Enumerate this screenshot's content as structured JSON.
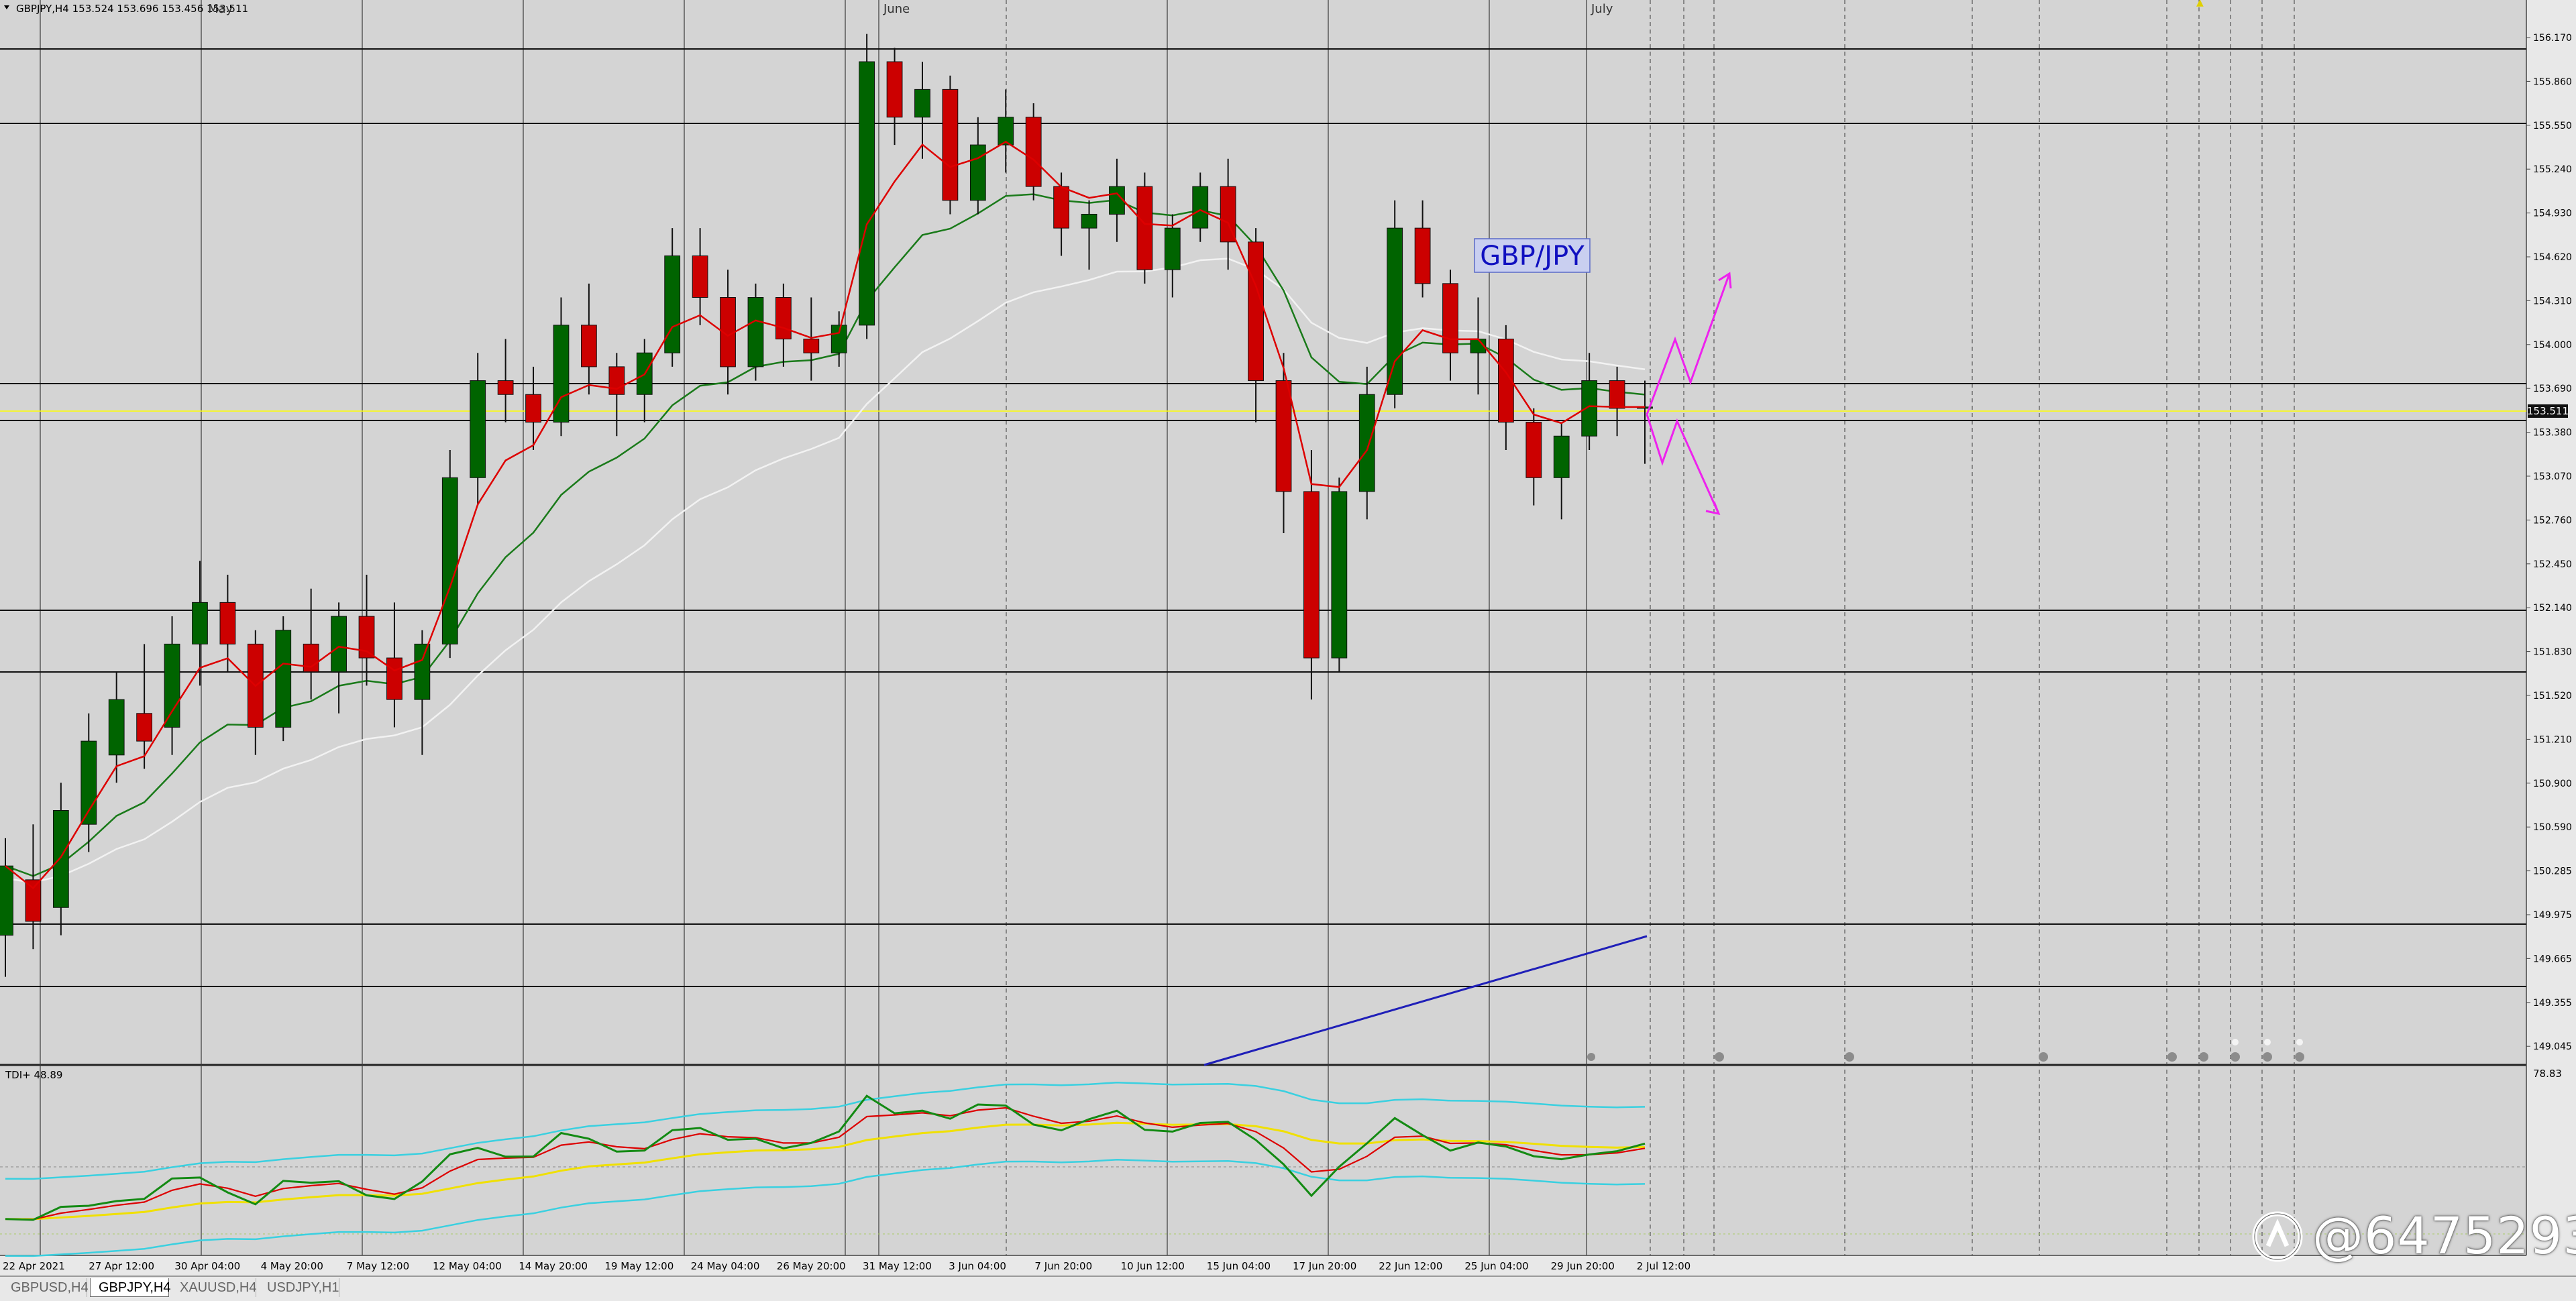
{
  "chart_header": {
    "symbol_info": "GBPJPY,H4  153.524 153.696 153.456 153.511"
  },
  "main_chart": {
    "month_labels": [
      "May",
      "June",
      "July"
    ],
    "overlay_label": "GBP/JPY",
    "current_price_tag": "153.511",
    "price_ticks": [
      "156.170",
      "155.860",
      "155.550",
      "155.240",
      "154.930",
      "154.620",
      "154.310",
      "154.000",
      "153.690",
      "153.380",
      "153.070",
      "152.760",
      "152.450",
      "152.140",
      "151.830",
      "151.520",
      "151.210",
      "150.900",
      "150.590",
      "150.285",
      "149.975",
      "149.665",
      "149.355",
      "149.045"
    ],
    "time_ticks": [
      "22 Apr 2021",
      "27 Apr 12:00",
      "30 Apr 04:00",
      "4 May 20:00",
      "7 May 12:00",
      "12 May 04:00",
      "14 May 20:00",
      "19 May 12:00",
      "24 May 04:00",
      "26 May 20:00",
      "31 May 12:00",
      "3 Jun 04:00",
      "7 Jun 20:00",
      "10 Jun 12:00",
      "15 Jun 04:00",
      "17 Jun 20:00",
      "22 Jun 12:00",
      "25 Jun 04:00",
      "29 Jun 20:00",
      "2 Jul 12:00"
    ]
  },
  "indicator": {
    "label": "TDI+ 48.89",
    "top_value": "78.83"
  },
  "tabs": [
    {
      "label": "GBPUSD,H4",
      "active": false
    },
    {
      "label": "GBPJPY,H4",
      "active": true
    },
    {
      "label": "XAUUSD,H4",
      "active": false
    },
    {
      "label": "USDJPY,H1",
      "active": false
    }
  ],
  "watermark": {
    "text": "@6475293"
  },
  "colors": {
    "background": "#d4d4d4",
    "bull_candle": "#006400",
    "bear_candle": "#cc0000",
    "fast_ma": "#dd0000",
    "mid_ma": "#1a7a1a",
    "slow_ma": "#f2f2f2",
    "projection": "#ee22ee",
    "blue_line": "#1f1fb8",
    "tdi_bands": "#3ad0e0",
    "tdi_signal": "#f0e000"
  },
  "chart_data": {
    "type": "candlestick",
    "symbol": "GBPJPY",
    "timeframe": "H4",
    "ylim": [
      148.9,
      156.3
    ],
    "candles": [
      [
        149.7,
        150.4,
        149.4,
        150.2
      ],
      [
        150.1,
        150.5,
        149.6,
        149.8
      ],
      [
        149.9,
        150.8,
        149.7,
        150.6
      ],
      [
        150.5,
        151.3,
        150.3,
        151.1
      ],
      [
        151.0,
        151.6,
        150.8,
        151.4
      ],
      [
        151.3,
        151.8,
        150.9,
        151.1
      ],
      [
        151.2,
        152.0,
        151.0,
        151.8
      ],
      [
        151.8,
        152.4,
        151.5,
        152.1
      ],
      [
        152.1,
        152.3,
        151.6,
        151.8
      ],
      [
        151.8,
        151.9,
        151.0,
        151.2
      ],
      [
        151.2,
        152.0,
        151.1,
        151.9
      ],
      [
        151.8,
        152.2,
        151.4,
        151.6
      ],
      [
        151.6,
        152.1,
        151.3,
        152.0
      ],
      [
        152.0,
        152.3,
        151.5,
        151.7
      ],
      [
        151.7,
        152.1,
        151.2,
        151.4
      ],
      [
        151.4,
        151.9,
        151.0,
        151.8
      ],
      [
        151.8,
        153.2,
        151.7,
        153.0
      ],
      [
        153.0,
        153.9,
        152.8,
        153.7
      ],
      [
        153.7,
        154.0,
        153.4,
        153.6
      ],
      [
        153.6,
        153.8,
        153.2,
        153.4
      ],
      [
        153.4,
        154.3,
        153.3,
        154.1
      ],
      [
        154.1,
        154.4,
        153.6,
        153.8
      ],
      [
        153.8,
        153.9,
        153.3,
        153.6
      ],
      [
        153.6,
        154.0,
        153.4,
        153.9
      ],
      [
        153.9,
        154.8,
        153.8,
        154.6
      ],
      [
        154.6,
        154.8,
        154.1,
        154.3
      ],
      [
        154.3,
        154.5,
        153.6,
        153.8
      ],
      [
        153.8,
        154.4,
        153.7,
        154.3
      ],
      [
        154.3,
        154.4,
        153.8,
        154.0
      ],
      [
        154.0,
        154.3,
        153.7,
        153.9
      ],
      [
        153.9,
        154.2,
        153.8,
        154.1
      ],
      [
        154.1,
        156.2,
        154.0,
        156.0
      ],
      [
        156.0,
        156.1,
        155.4,
        155.6
      ],
      [
        155.6,
        156.0,
        155.3,
        155.8
      ],
      [
        155.8,
        155.9,
        154.9,
        155.0
      ],
      [
        155.0,
        155.6,
        154.9,
        155.4
      ],
      [
        155.4,
        155.8,
        155.2,
        155.6
      ],
      [
        155.6,
        155.7,
        155.0,
        155.1
      ],
      [
        155.1,
        155.2,
        154.6,
        154.8
      ],
      [
        154.8,
        155.0,
        154.5,
        154.9
      ],
      [
        154.9,
        155.3,
        154.7,
        155.1
      ],
      [
        155.1,
        155.2,
        154.4,
        154.5
      ],
      [
        154.5,
        154.9,
        154.3,
        154.8
      ],
      [
        154.8,
        155.2,
        154.7,
        155.1
      ],
      [
        155.1,
        155.3,
        154.5,
        154.7
      ],
      [
        154.7,
        154.8,
        153.4,
        153.7
      ],
      [
        153.7,
        153.9,
        152.6,
        152.9
      ],
      [
        152.9,
        153.2,
        151.4,
        151.7
      ],
      [
        151.7,
        153.0,
        151.6,
        152.9
      ],
      [
        152.9,
        153.8,
        152.7,
        153.6
      ],
      [
        153.6,
        155.0,
        153.5,
        154.8
      ],
      [
        154.8,
        155.0,
        154.3,
        154.4
      ],
      [
        154.4,
        154.5,
        153.7,
        153.9
      ],
      [
        153.9,
        154.3,
        153.6,
        154.0
      ],
      [
        154.0,
        154.1,
        153.2,
        153.4
      ],
      [
        153.4,
        153.5,
        152.8,
        153.0
      ],
      [
        153.0,
        153.4,
        152.7,
        153.3
      ],
      [
        153.3,
        153.9,
        153.2,
        153.7
      ],
      [
        153.7,
        153.8,
        153.3,
        153.5
      ],
      [
        153.5,
        153.7,
        153.1,
        153.51
      ]
    ]
  }
}
